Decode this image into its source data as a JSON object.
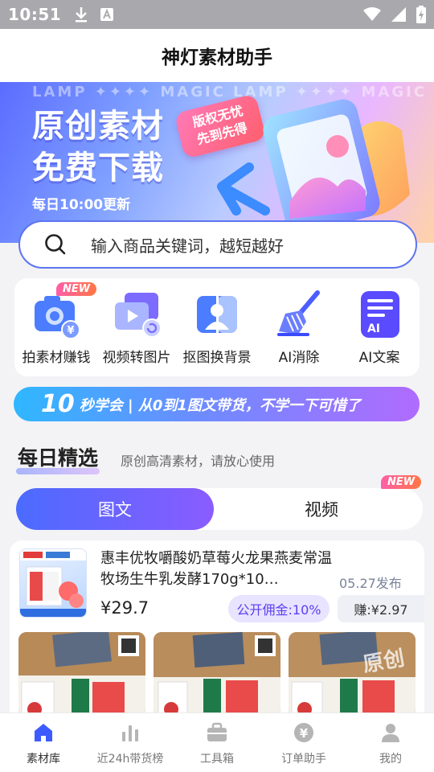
{
  "status_bar": {
    "time": "10:51"
  },
  "header": {
    "title": "神灯素材助手"
  },
  "banner": {
    "watermark": "LAMP ✦✦✦✦ MAGIC LAMP ✦✦✦✦ MAGIC LAMP",
    "headline_1": "原创素材",
    "headline_2": "免费下载",
    "tag_line_1": "版权无忧",
    "tag_line_2": "先到先得",
    "subtext": "每日10:00更新"
  },
  "search": {
    "placeholder": "输入商品关键词，越短越好"
  },
  "tools": [
    {
      "label": "拍素材赚钱",
      "badge": "NEW"
    },
    {
      "label": "视频转图片"
    },
    {
      "label": "抠图换背景"
    },
    {
      "label": "AI消除"
    },
    {
      "label": "AI文案"
    }
  ],
  "promo": {
    "number": "10",
    "text": "秒学会 | 从0到1图文带货，不学一下可惜了"
  },
  "daily": {
    "title": "每日精选",
    "subtitle": "原创高清素材，请放心使用"
  },
  "segment": {
    "tab_1": "图文",
    "tab_2": "视频",
    "new_badge": "NEW"
  },
  "product": {
    "title": "惠丰优牧嚼酸奶草莓火龙果燕麦常温牧场生牛乳发酵170g*10…",
    "date": "05.27发布",
    "price": "¥29.7",
    "commission": "公开佣金:10%",
    "earn": "赚:¥2.97",
    "watermark": "原创"
  },
  "tabbar": {
    "items": [
      {
        "label": "素材库"
      },
      {
        "label": "近24h带货榜"
      },
      {
        "label": "工具箱"
      },
      {
        "label": "订单助手"
      },
      {
        "label": "我的"
      }
    ]
  },
  "colors": {
    "accent": "#4b6bff",
    "accent_2": "#8a5cff",
    "commission_text": "#5b3ff0"
  }
}
